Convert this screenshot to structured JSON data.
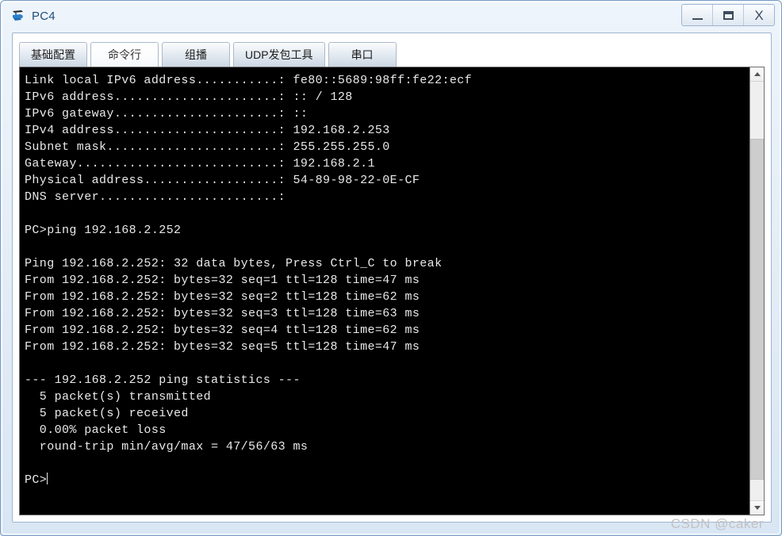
{
  "window": {
    "title": "PC4",
    "icon": "pc-device-icon",
    "buttons": {
      "minimize": "minimize-button",
      "maximize": "maximize-button",
      "close": "X"
    }
  },
  "tabs": [
    {
      "label": "基础配置",
      "active": false
    },
    {
      "label": "命令行",
      "active": true
    },
    {
      "label": "组播",
      "active": false
    },
    {
      "label": "UDP发包工具",
      "active": false
    },
    {
      "label": "串口",
      "active": false
    }
  ],
  "terminal": {
    "background_color": "#000000",
    "text_color": "#e9e9e9",
    "prompt": "PC>",
    "lines": [
      "Link local IPv6 address...........: fe80::5689:98ff:fe22:ecf",
      "IPv6 address......................: :: / 128",
      "IPv6 gateway......................: ::",
      "IPv4 address......................: 192.168.2.253",
      "Subnet mask.......................: 255.255.255.0",
      "Gateway...........................: 192.168.2.1",
      "Physical address..................: 54-89-98-22-0E-CF",
      "DNS server........................:",
      "",
      "PC>ping 192.168.2.252",
      "",
      "Ping 192.168.2.252: 32 data bytes, Press Ctrl_C to break",
      "From 192.168.2.252: bytes=32 seq=1 ttl=128 time=47 ms",
      "From 192.168.2.252: bytes=32 seq=2 ttl=128 time=62 ms",
      "From 192.168.2.252: bytes=32 seq=3 ttl=128 time=63 ms",
      "From 192.168.2.252: bytes=32 seq=4 ttl=128 time=62 ms",
      "From 192.168.2.252: bytes=32 seq=5 ttl=128 time=47 ms",
      "",
      "--- 192.168.2.252 ping statistics ---",
      "  5 packet(s) transmitted",
      "  5 packet(s) received",
      "  0.00% packet loss",
      "  round-trip min/avg/max = 47/56/63 ms",
      "",
      "PC>"
    ]
  },
  "scrollbar": {
    "up_arrow": "scroll-up-icon",
    "down_arrow": "scroll-down-icon"
  },
  "watermark": {
    "text": "CSDN @caker"
  }
}
